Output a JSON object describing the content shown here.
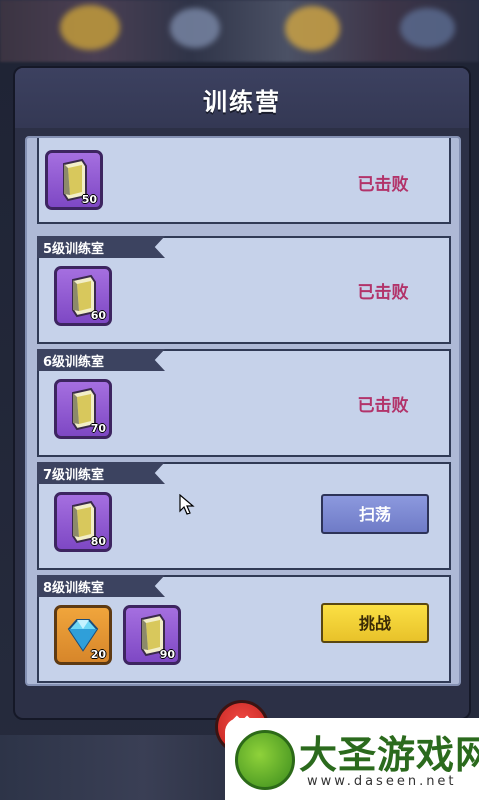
{
  "dialog": {
    "title": "训练营"
  },
  "rooms": [
    {
      "label": "",
      "rewards": [
        {
          "kind": "book-purple",
          "count": "50"
        }
      ],
      "state": "defeated",
      "status_text": "已击败"
    },
    {
      "label": "5级训练室",
      "rewards": [
        {
          "kind": "book-purple",
          "count": "60"
        }
      ],
      "state": "defeated",
      "status_text": "已击败"
    },
    {
      "label": "6级训练室",
      "rewards": [
        {
          "kind": "book-purple",
          "count": "70"
        }
      ],
      "state": "defeated",
      "status_text": "已击败"
    },
    {
      "label": "7级训练室",
      "rewards": [
        {
          "kind": "book-purple",
          "count": "80"
        }
      ],
      "state": "sweep",
      "button_label": "扫荡"
    },
    {
      "label": "8级训练室",
      "rewards": [
        {
          "kind": "diamond",
          "count": "20"
        },
        {
          "kind": "book-purple",
          "count": "90"
        }
      ],
      "state": "challenge",
      "button_label": "挑战"
    }
  ],
  "close_button": {
    "icon": "close-x-icon",
    "glyph": "✖"
  },
  "watermark": {
    "brand": "大圣游戏网",
    "url": "www.daseen.net"
  },
  "colors": {
    "defeated_text": "#b2336a",
    "sweep_button": "#7b87d3",
    "challenge_button": "#f6d436"
  }
}
